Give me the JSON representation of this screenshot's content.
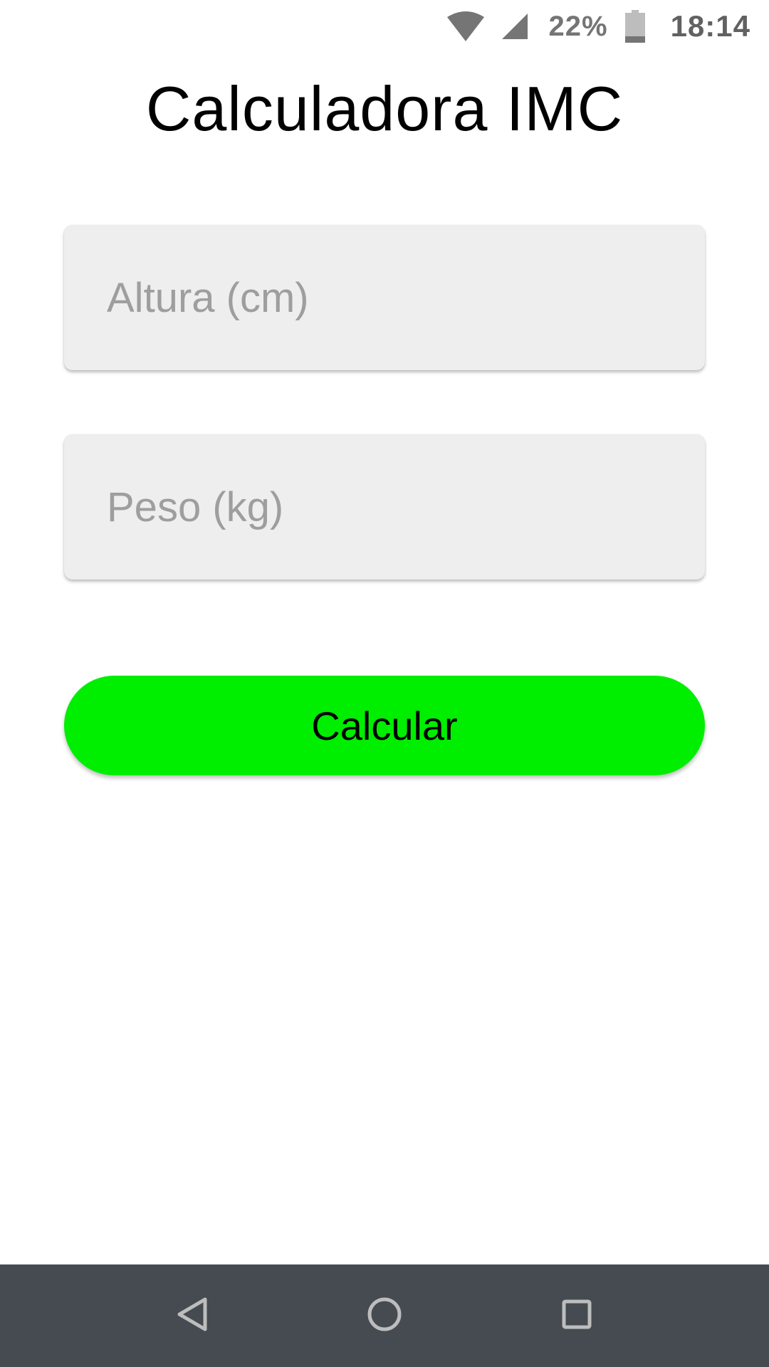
{
  "status_bar": {
    "wifi_icon": "wifi-icon",
    "signal_icon": "cell-signal-icon",
    "battery_percent": "22%",
    "battery_icon": "battery-icon",
    "battery_level": 0.22,
    "time": "18:14"
  },
  "app": {
    "title": "Calculadora IMC"
  },
  "form": {
    "altura": {
      "placeholder": "Altura (cm)",
      "value": ""
    },
    "peso": {
      "placeholder": "Peso (kg)",
      "value": ""
    },
    "calcular_label": "Calcular"
  },
  "nav_bar": {
    "back_icon": "back-triangle-icon",
    "home_icon": "home-circle-icon",
    "recent_icon": "recent-apps-square-icon"
  },
  "colors": {
    "button_green": "#00ee00",
    "field_bg": "#eeeeee",
    "nav_bar_bg": "#454b51",
    "placeholder": "#9e9e9e"
  }
}
